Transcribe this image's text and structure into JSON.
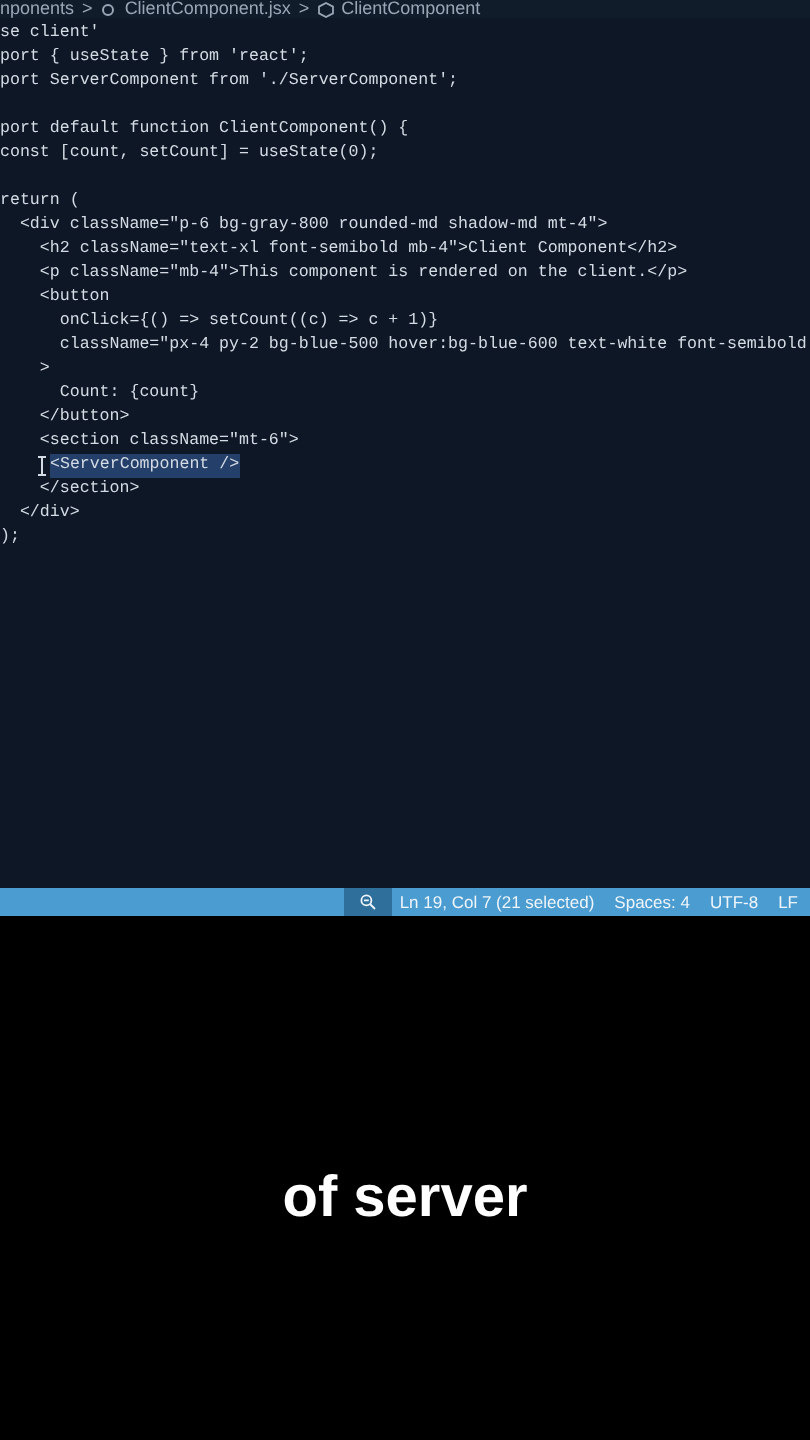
{
  "breadcrumb": {
    "folder": "nponents",
    "file": "ClientComponent.jsx",
    "symbol": "ClientComponent",
    "separator": ">"
  },
  "code_lines": [
    {
      "kind": "code",
      "text": "se client'"
    },
    {
      "kind": "code",
      "text": "port { useState } from 'react';"
    },
    {
      "kind": "code",
      "text": "port ServerComponent from './ServerComponent';"
    },
    {
      "kind": "blank"
    },
    {
      "kind": "code",
      "text": "port default function ClientComponent() {"
    },
    {
      "kind": "code",
      "text": "const [count, setCount] = useState(0);"
    },
    {
      "kind": "blank"
    },
    {
      "kind": "code",
      "text": "return ("
    },
    {
      "kind": "code",
      "text": "  <div className=\"p-6 bg-gray-800 rounded-md shadow-md mt-4\">"
    },
    {
      "kind": "code",
      "text": "    <h2 className=\"text-xl font-semibold mb-4\">Client Component</h2>"
    },
    {
      "kind": "code",
      "text": "    <p className=\"mb-4\">This component is rendered on the client.</p>"
    },
    {
      "kind": "code",
      "text": "    <button"
    },
    {
      "kind": "code",
      "text": "      onClick={() => setCount((c) => c + 1)}"
    },
    {
      "kind": "code",
      "text": "      className=\"px-4 py-2 bg-blue-500 hover:bg-blue-600 text-white font-semibold"
    },
    {
      "kind": "code",
      "text": "    >"
    },
    {
      "kind": "code",
      "text": "      Count: {count}"
    },
    {
      "kind": "code",
      "text": "    </button>"
    },
    {
      "kind": "code",
      "text": "    <section className=\"mt-6\">"
    },
    {
      "kind": "cursor",
      "text": "<ServerComponent />",
      "selected": true
    },
    {
      "kind": "code",
      "text": "    </section>"
    },
    {
      "kind": "code",
      "text": "  </div>"
    },
    {
      "kind": "code",
      "text": ");"
    }
  ],
  "status_bar": {
    "position": "Ln 19, Col 7 (21 selected)",
    "spaces": "Spaces: 4",
    "encoding": "UTF-8",
    "eol": "LF"
  },
  "caption": "of server"
}
